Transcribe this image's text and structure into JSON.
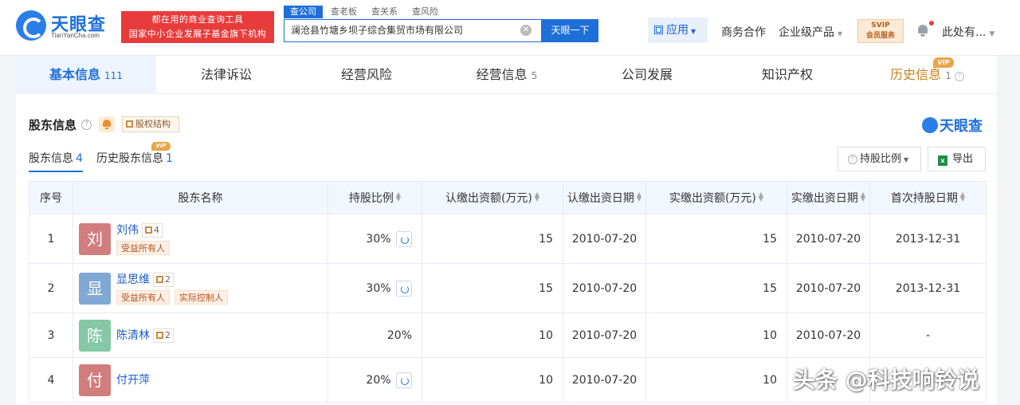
{
  "brand": {
    "name": "天眼查",
    "domain": "TianYanCha.com"
  },
  "slogan": {
    "line1": "都在用的商业查询工具",
    "line2": "国家中小企业发展子基金旗下机构"
  },
  "search": {
    "tabs": [
      "查公司",
      "查老板",
      "查关系",
      "查风险"
    ],
    "query": "澜沧县竹塘乡坝子综合集贸市场有限公司",
    "button": "天眼一下"
  },
  "topnav": {
    "apps": "应用",
    "cooperation": "商务合作",
    "enterprise": "企业级产品",
    "svip_line1": "SVIP",
    "svip_line2": "会员服务",
    "user": "此处有..."
  },
  "main_tabs": [
    {
      "label": "基本信息",
      "count": "111"
    },
    {
      "label": "法律诉讼",
      "count": ""
    },
    {
      "label": "经营风险",
      "count": ""
    },
    {
      "label": "经营信息",
      "count": "5"
    },
    {
      "label": "公司发展",
      "count": ""
    },
    {
      "label": "知识产权",
      "count": ""
    },
    {
      "label": "历史信息",
      "count": "1"
    }
  ],
  "vip_badge": "VIP",
  "section": {
    "title": "股东信息",
    "structure_btn": "股权结构",
    "logo_text": "天眼查",
    "sub_tabs": [
      {
        "label": "股东信息",
        "count": "4"
      },
      {
        "label": "历史股东信息",
        "count": "1"
      }
    ],
    "ratio_btn": "持股比例",
    "export_btn": "导出",
    "excel_icon_letter": "x"
  },
  "table": {
    "headers": [
      "序号",
      "股东名称",
      "持股比例",
      "认缴出资额(万元)",
      "认缴出资日期",
      "实缴出资额(万元)",
      "实缴出资日期",
      "首次持股日期"
    ],
    "rows": [
      {
        "no": "1",
        "avatar": "刘",
        "avatar_color": "#d17d7d",
        "name": "刘伟",
        "chain": "4",
        "tags": [
          "受益所有人"
        ],
        "ratio": "30%",
        "sub_amount": "15",
        "sub_date": "2010-07-20",
        "paid_amount": "15",
        "paid_date": "2010-07-20",
        "first_date": "2013-12-31"
      },
      {
        "no": "2",
        "avatar": "显",
        "avatar_color": "#7fa8d4",
        "name": "显思维",
        "chain": "2",
        "tags": [
          "受益所有人",
          "实际控制人"
        ],
        "ratio": "30%",
        "sub_amount": "15",
        "sub_date": "2010-07-20",
        "paid_amount": "15",
        "paid_date": "2010-07-20",
        "first_date": "2013-12-31"
      },
      {
        "no": "3",
        "avatar": "陈",
        "avatar_color": "#85c7a6",
        "name": "陈清林",
        "chain": "2",
        "tags": [],
        "ratio": "20%",
        "sub_amount": "10",
        "sub_date": "2010-07-20",
        "paid_amount": "10",
        "paid_date": "2010-07-20",
        "first_date": "-"
      },
      {
        "no": "4",
        "avatar": "付",
        "avatar_color": "#d17d7d",
        "name": "付开萍",
        "chain": "",
        "tags": [],
        "ratio": "20%",
        "sub_amount": "10",
        "sub_date": "2010-07-20",
        "paid_amount": "10",
        "paid_date": "",
        "first_date": ""
      }
    ]
  },
  "watermark": "头条 @科技响铃说"
}
